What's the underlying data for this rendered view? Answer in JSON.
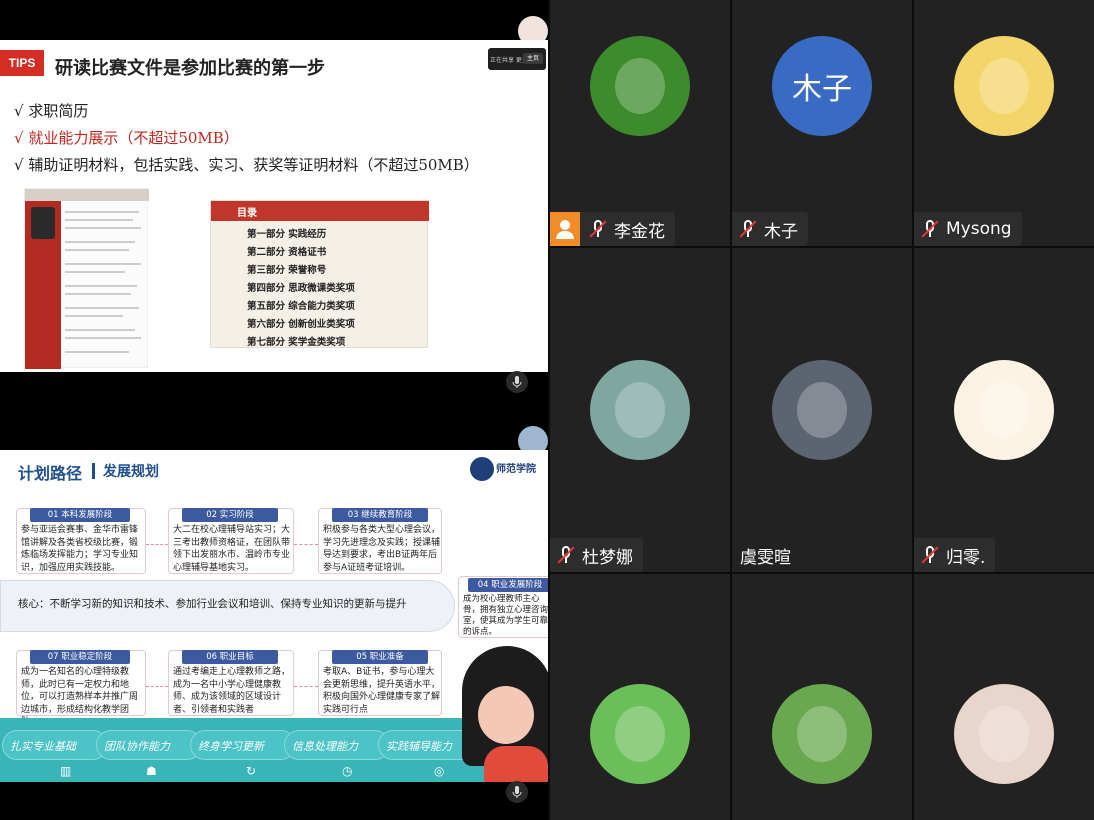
{
  "screen_share_top": {
    "tips_label": "TIPS",
    "title": "研读比赛文件是参加比赛的第一步",
    "bullets": [
      {
        "text": "√ 求职简历",
        "highlight": false
      },
      {
        "text": "√ 就业能力展示（不超过50MB）",
        "highlight": true
      },
      {
        "text": "√ 辅助证明材料，包括实践、实习、获奖等证明材料（不超过50MB）",
        "highlight": false
      }
    ],
    "toc_header": "目录",
    "toc_items": [
      "第一部分 实践经历",
      "第二部分 资格证书",
      "第三部分 荣誉称号",
      "第四部分 思政微课类奖项",
      "第五部分 综合能力类奖项",
      "第六部分 创新创业类奖项",
      "第七部分 奖学金类奖项"
    ],
    "control_text": "正在共享  更多",
    "control_button": "主页"
  },
  "screen_share_bottom": {
    "title": "计划路径",
    "subtitle": "发展规划",
    "logo_text": "师范学院",
    "stages": [
      {
        "tag": "01 本科发展阶段",
        "text": "参与亚运会赛事、金华市雷锋馆讲解及各类省校级比赛，锻炼临场发挥能力；学习专业知识，加强应用实践技能。"
      },
      {
        "tag": "02 实习阶段",
        "text": "大二在校心理辅导站实习；大三考出教师资格证，在团队带领下出发丽水市、温岭市专业心理辅导基地实习。"
      },
      {
        "tag": "03 继续教育阶段",
        "text": "积极参与各类大型心理会议，学习先进理念及实践；授课辅导达到要求，考出B证两年后参与A证班考证培训。"
      },
      {
        "tag": "04 职业发展阶段",
        "text": "成为校心理教师主心骨，拥有独立心理咨询室，使其成为学生可靠的诉点。"
      },
      {
        "tag": "05 职业准备",
        "text": "考取A、B证书，参与心理大会更新思维，提升英语水平，积极向国外心理健康专家了解实践可行点"
      },
      {
        "tag": "06 职业目标",
        "text": "通过考编走上心理教师之路，成为一名中小学心理健康教师、成为该领域的区域设计者、引领者和实践者"
      },
      {
        "tag": "07 职业稳定阶段",
        "text": "成为一名知名的心理特级教师，此时已有一定权力和地位，可以打造熟样本并推广周边城市，形成结构化教学团队。"
      }
    ],
    "core_text": "核心：不断学习新的知识和技术、参加行业会议和培训、保持专业知识的更新与提升",
    "pills": [
      "扎实专业基础",
      "团队协作能力",
      "终身学习更新",
      "信息处理能力",
      "实践辅导能力"
    ]
  },
  "participants": [
    {
      "name": "李金花",
      "muted": true,
      "avatar": "lettuce-avatar",
      "color": "#3d8b2c"
    },
    {
      "name": "木子",
      "muted": true,
      "avatar": "initials-avatar",
      "initials": "木子",
      "color": "#3a6bc4"
    },
    {
      "name": "Mysong",
      "muted": true,
      "avatar": "anime-girl-avatar",
      "color": "#f3d56a"
    },
    {
      "name": "杜梦娜",
      "muted": true,
      "avatar": "painting-avatar",
      "color": "#7fa7a0"
    },
    {
      "name": "虞雯暄",
      "muted": false,
      "avatar": "snow-avatar",
      "color": "#5b6470"
    },
    {
      "name": "归零.",
      "muted": true,
      "avatar": "bunny-avatar",
      "color": "#fdf3e5"
    },
    {
      "name": "",
      "muted": false,
      "avatar": "girl-photo-avatar",
      "color": "#6bbf59"
    },
    {
      "name": "",
      "muted": false,
      "avatar": "green-blob-avatar",
      "color": "#6aa84f"
    },
    {
      "name": "",
      "muted": false,
      "avatar": "selfie-avatar",
      "color": "#e8d6cc"
    }
  ]
}
